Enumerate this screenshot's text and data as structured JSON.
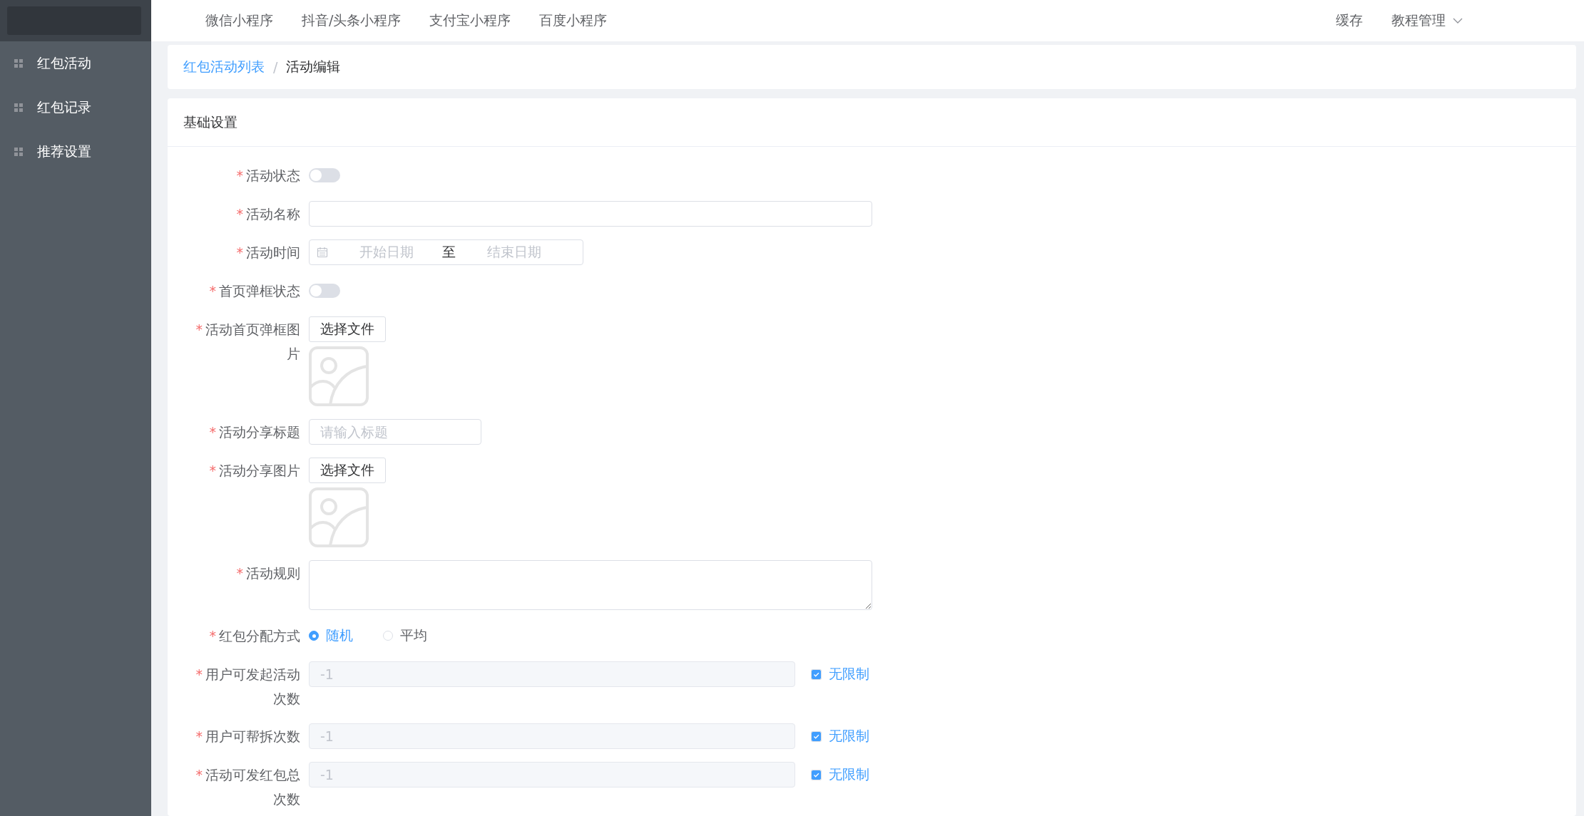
{
  "sidebar": {
    "items": [
      {
        "label": "红包活动"
      },
      {
        "label": "红包记录"
      },
      {
        "label": "推荐设置"
      }
    ]
  },
  "top_nav": {
    "items": [
      "微信小程序",
      "抖音/头条小程序",
      "支付宝小程序",
      "百度小程序"
    ],
    "right_items": [
      {
        "label": "缓存",
        "kind": "link"
      },
      {
        "label": "教程管理",
        "kind": "dropdown"
      }
    ]
  },
  "breadcrumb": {
    "separator": "/",
    "items": [
      {
        "label": "红包活动列表",
        "kind": "link"
      },
      {
        "label": "活动编辑",
        "kind": "current"
      }
    ]
  },
  "form": {
    "title": "基础设置",
    "fields": [
      {
        "kind": "switch",
        "mark": "*",
        "label": "活动状态",
        "on": false
      },
      {
        "kind": "text",
        "mark": "*",
        "label": "活动名称"
      },
      {
        "kind": "date_range",
        "mark": "*",
        "label": "活动时间",
        "start_placeholder": "开始日期",
        "separator": "至",
        "end_placeholder": "结束日期"
      },
      {
        "kind": "switch",
        "mark": "*",
        "label": "首页弹框状态",
        "on": false
      },
      {
        "kind": "upload",
        "mark": "*",
        "label": "活动首页弹框图片",
        "button": "选择文件"
      },
      {
        "kind": "short_text",
        "mark": "*",
        "label": "活动分享标题",
        "placeholder": "请输入标题"
      },
      {
        "kind": "upload",
        "mark": "*",
        "label": "活动分享图片",
        "button": "选择文件"
      },
      {
        "kind": "textarea",
        "mark": "*",
        "label": "活动规则"
      },
      {
        "kind": "radio",
        "mark": "*",
        "label": "红包分配方式",
        "options": [
          {
            "label": "随机",
            "selected": true
          },
          {
            "label": "平均",
            "selected": false
          }
        ]
      },
      {
        "kind": "limit",
        "mark": "*",
        "label": "用户可发起活动次数",
        "value": "-1",
        "disabled": true,
        "checkbox": {
          "label": "无限制",
          "checked": true
        }
      },
      {
        "kind": "limit",
        "mark": "*",
        "label": "用户可帮拆次数",
        "value": "-1",
        "disabled": true,
        "checkbox": {
          "label": "无限制",
          "checked": true
        }
      },
      {
        "kind": "limit",
        "mark": "*",
        "label": "活动可发红包总次数",
        "value": "-1",
        "disabled": true,
        "checkbox": {
          "label": "无限制",
          "checked": true
        }
      }
    ]
  }
}
